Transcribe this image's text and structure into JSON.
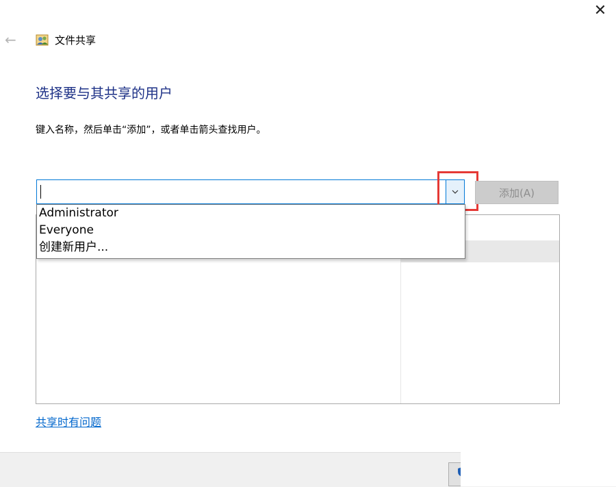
{
  "window": {
    "title": "文件共享",
    "close_symbol": "✕",
    "back_symbol": "←"
  },
  "page": {
    "heading": "选择要与其共享的用户",
    "instruction": "键入名称，然后单击“添加”，或者单击箭头查找用户。"
  },
  "name_input": {
    "value": "",
    "dropdown_icon": "chevron-down-icon"
  },
  "add_button": {
    "label": "添加(A)"
  },
  "dropdown": {
    "items": [
      "Administrator",
      "Everyone",
      "创建新用户..."
    ]
  },
  "help_link": "共享时有问题",
  "colors": {
    "heading": "#1e3287",
    "link": "#0066cc",
    "accent": "#0078d7",
    "highlight": "#e53935"
  }
}
